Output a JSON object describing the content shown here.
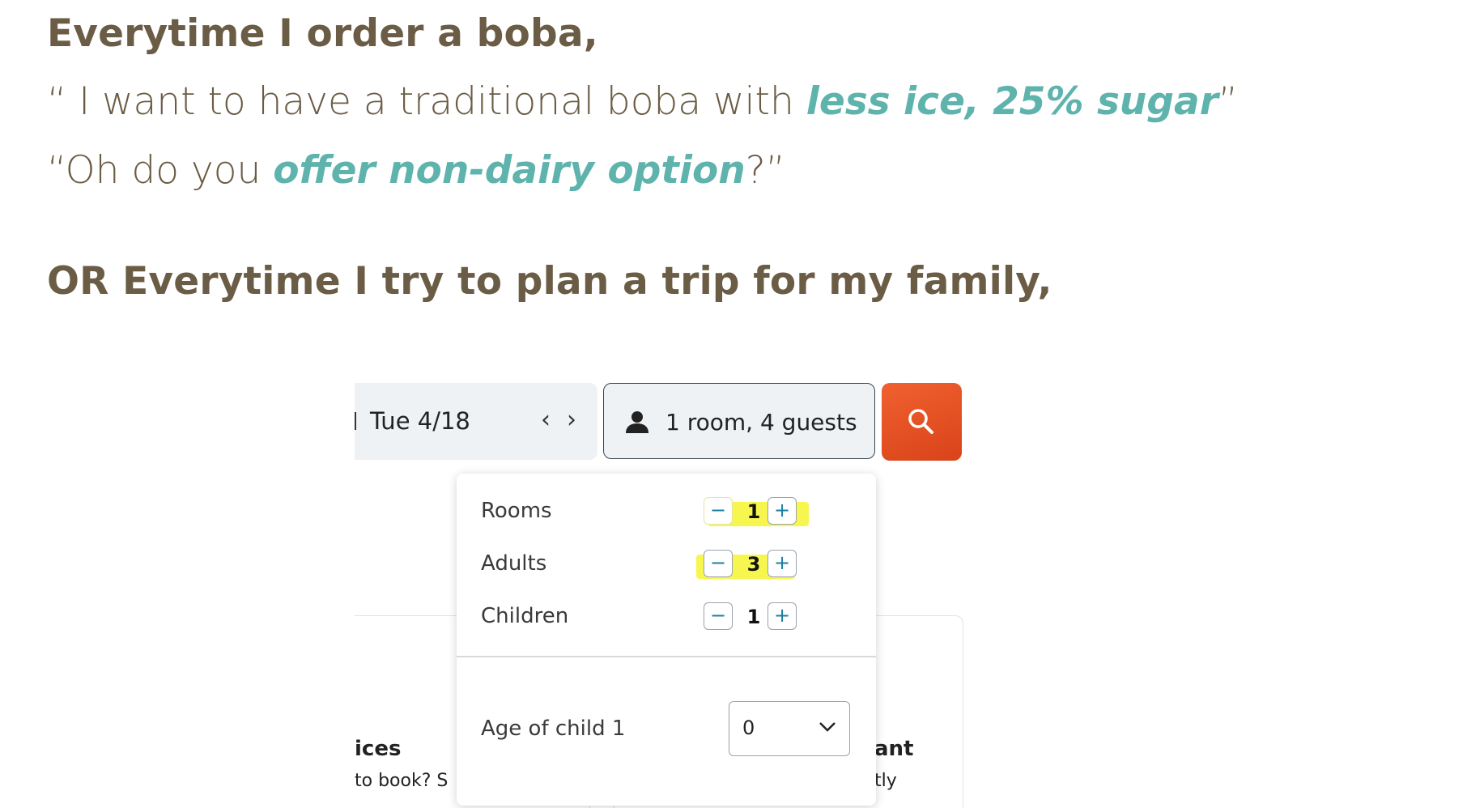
{
  "slide": {
    "heading1": "Everytime I order a boba,",
    "quote1": {
      "open": "“ I want to have a traditional boba with ",
      "highlight": "less ice, 25% sugar",
      "close": "”"
    },
    "quote2": {
      "open": "“Oh do you ",
      "highlight": "offer non-dairy option",
      "close": "?”"
    },
    "heading2": "OR Everytime I try to plan a trip for my family,"
  },
  "colors": {
    "text": "#6b5c45",
    "highlight": "#5fb3ad",
    "search_button": "#e8532a",
    "marker": "#f5f530"
  },
  "booking": {
    "date": "Tue 4/18",
    "prev_icon": "chevron-left-icon",
    "next_icon": "chevron-right-icon",
    "guests_summary": "1 room, 4 guests",
    "search_icon": "search-icon",
    "background_snippets": {
      "left_title": "ices",
      "left_line": "to book? S",
      "right_title": "ant",
      "right_line": "tly"
    },
    "panel": {
      "rows": [
        {
          "label": "Rooms",
          "value": "1",
          "minus": "−",
          "plus": "+"
        },
        {
          "label": "Adults",
          "value": "3",
          "minus": "−",
          "plus": "+"
        },
        {
          "label": "Children",
          "value": "1",
          "minus": "−",
          "plus": "+"
        }
      ],
      "age_label": "Age of child 1",
      "age_value": "0"
    }
  }
}
